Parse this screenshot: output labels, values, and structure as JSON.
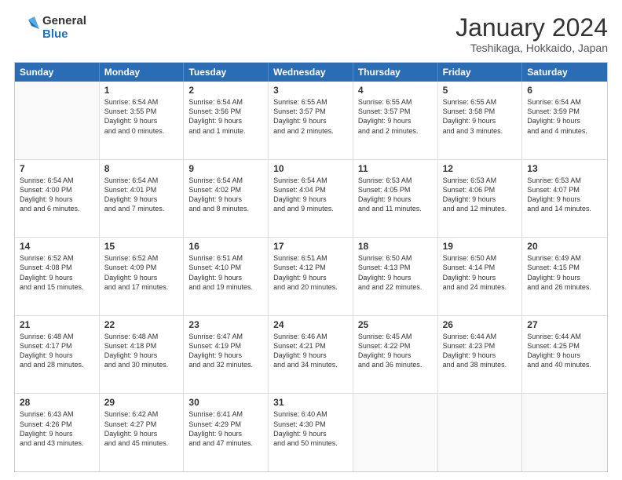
{
  "header": {
    "logo_line1": "General",
    "logo_line2": "Blue",
    "month_title": "January 2024",
    "subtitle": "Teshikaga, Hokkaido, Japan"
  },
  "weekdays": [
    "Sunday",
    "Monday",
    "Tuesday",
    "Wednesday",
    "Thursday",
    "Friday",
    "Saturday"
  ],
  "rows": [
    [
      {
        "day": "",
        "empty": true
      },
      {
        "day": "1",
        "sunrise": "6:54 AM",
        "sunset": "3:55 PM",
        "daylight": "9 hours and 0 minutes."
      },
      {
        "day": "2",
        "sunrise": "6:54 AM",
        "sunset": "3:56 PM",
        "daylight": "9 hours and 1 minute."
      },
      {
        "day": "3",
        "sunrise": "6:55 AM",
        "sunset": "3:57 PM",
        "daylight": "9 hours and 2 minutes."
      },
      {
        "day": "4",
        "sunrise": "6:55 AM",
        "sunset": "3:57 PM",
        "daylight": "9 hours and 2 minutes."
      },
      {
        "day": "5",
        "sunrise": "6:55 AM",
        "sunset": "3:58 PM",
        "daylight": "9 hours and 3 minutes."
      },
      {
        "day": "6",
        "sunrise": "6:54 AM",
        "sunset": "3:59 PM",
        "daylight": "9 hours and 4 minutes."
      }
    ],
    [
      {
        "day": "7",
        "sunrise": "6:54 AM",
        "sunset": "4:00 PM",
        "daylight": "9 hours and 6 minutes."
      },
      {
        "day": "8",
        "sunrise": "6:54 AM",
        "sunset": "4:01 PM",
        "daylight": "9 hours and 7 minutes."
      },
      {
        "day": "9",
        "sunrise": "6:54 AM",
        "sunset": "4:02 PM",
        "daylight": "9 hours and 8 minutes."
      },
      {
        "day": "10",
        "sunrise": "6:54 AM",
        "sunset": "4:04 PM",
        "daylight": "9 hours and 9 minutes."
      },
      {
        "day": "11",
        "sunrise": "6:53 AM",
        "sunset": "4:05 PM",
        "daylight": "9 hours and 11 minutes."
      },
      {
        "day": "12",
        "sunrise": "6:53 AM",
        "sunset": "4:06 PM",
        "daylight": "9 hours and 12 minutes."
      },
      {
        "day": "13",
        "sunrise": "6:53 AM",
        "sunset": "4:07 PM",
        "daylight": "9 hours and 14 minutes."
      }
    ],
    [
      {
        "day": "14",
        "sunrise": "6:52 AM",
        "sunset": "4:08 PM",
        "daylight": "9 hours and 15 minutes."
      },
      {
        "day": "15",
        "sunrise": "6:52 AM",
        "sunset": "4:09 PM",
        "daylight": "9 hours and 17 minutes."
      },
      {
        "day": "16",
        "sunrise": "6:51 AM",
        "sunset": "4:10 PM",
        "daylight": "9 hours and 19 minutes."
      },
      {
        "day": "17",
        "sunrise": "6:51 AM",
        "sunset": "4:12 PM",
        "daylight": "9 hours and 20 minutes."
      },
      {
        "day": "18",
        "sunrise": "6:50 AM",
        "sunset": "4:13 PM",
        "daylight": "9 hours and 22 minutes."
      },
      {
        "day": "19",
        "sunrise": "6:50 AM",
        "sunset": "4:14 PM",
        "daylight": "9 hours and 24 minutes."
      },
      {
        "day": "20",
        "sunrise": "6:49 AM",
        "sunset": "4:15 PM",
        "daylight": "9 hours and 26 minutes."
      }
    ],
    [
      {
        "day": "21",
        "sunrise": "6:48 AM",
        "sunset": "4:17 PM",
        "daylight": "9 hours and 28 minutes."
      },
      {
        "day": "22",
        "sunrise": "6:48 AM",
        "sunset": "4:18 PM",
        "daylight": "9 hours and 30 minutes."
      },
      {
        "day": "23",
        "sunrise": "6:47 AM",
        "sunset": "4:19 PM",
        "daylight": "9 hours and 32 minutes."
      },
      {
        "day": "24",
        "sunrise": "6:46 AM",
        "sunset": "4:21 PM",
        "daylight": "9 hours and 34 minutes."
      },
      {
        "day": "25",
        "sunrise": "6:45 AM",
        "sunset": "4:22 PM",
        "daylight": "9 hours and 36 minutes."
      },
      {
        "day": "26",
        "sunrise": "6:44 AM",
        "sunset": "4:23 PM",
        "daylight": "9 hours and 38 minutes."
      },
      {
        "day": "27",
        "sunrise": "6:44 AM",
        "sunset": "4:25 PM",
        "daylight": "9 hours and 40 minutes."
      }
    ],
    [
      {
        "day": "28",
        "sunrise": "6:43 AM",
        "sunset": "4:26 PM",
        "daylight": "9 hours and 43 minutes."
      },
      {
        "day": "29",
        "sunrise": "6:42 AM",
        "sunset": "4:27 PM",
        "daylight": "9 hours and 45 minutes."
      },
      {
        "day": "30",
        "sunrise": "6:41 AM",
        "sunset": "4:29 PM",
        "daylight": "9 hours and 47 minutes."
      },
      {
        "day": "31",
        "sunrise": "6:40 AM",
        "sunset": "4:30 PM",
        "daylight": "9 hours and 50 minutes."
      },
      {
        "day": "",
        "empty": true
      },
      {
        "day": "",
        "empty": true
      },
      {
        "day": "",
        "empty": true
      }
    ]
  ]
}
